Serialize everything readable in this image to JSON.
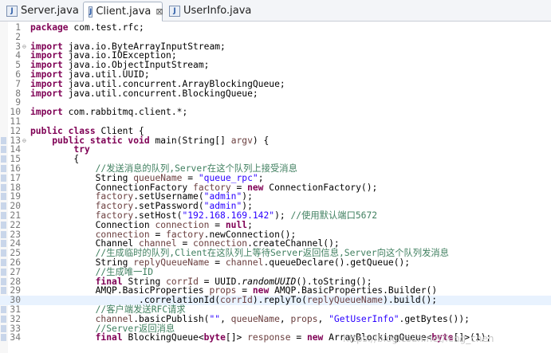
{
  "tabs": [
    {
      "label": "Server.java",
      "icon": "java-file-icon",
      "active": false
    },
    {
      "label": "Client.java",
      "icon": "java-file-icon",
      "active": true,
      "close": "⊠"
    },
    {
      "label": "UserInfo.java",
      "icon": "java-file-icon",
      "active": false
    }
  ],
  "editor": {
    "current_line": 30,
    "lines": [
      {
        "n": "1",
        "t": [
          [
            "kw",
            "package"
          ],
          [
            "",
            "com.test.rfc;"
          ]
        ]
      },
      {
        "n": "2",
        "t": []
      },
      {
        "n": "3",
        "fold": "⊖",
        "t": [
          [
            "kw",
            "import"
          ],
          [
            "",
            "java.io.ByteArrayInputStream;"
          ]
        ]
      },
      {
        "n": "4",
        "t": [
          [
            "kw",
            "import"
          ],
          [
            "",
            "java.io.IOException;"
          ]
        ]
      },
      {
        "n": "5",
        "t": [
          [
            "kw",
            "import"
          ],
          [
            "",
            "java.io.ObjectInputStream;"
          ]
        ]
      },
      {
        "n": "6",
        "t": [
          [
            "kw",
            "import"
          ],
          [
            "",
            "java.util.UUID;"
          ]
        ]
      },
      {
        "n": "7",
        "t": [
          [
            "kw",
            "import"
          ],
          [
            "",
            "java.util.concurrent.ArrayBlockingQueue;"
          ]
        ]
      },
      {
        "n": "8",
        "t": [
          [
            "kw",
            "import"
          ],
          [
            "",
            "java.util.concurrent.BlockingQueue;"
          ]
        ]
      },
      {
        "n": "9",
        "t": []
      },
      {
        "n": "10",
        "t": [
          [
            "kw",
            "import"
          ],
          [
            "",
            "com.rabbitmq.client.*;"
          ]
        ]
      },
      {
        "n": "11",
        "t": []
      },
      {
        "n": "12",
        "t": [
          [
            "kw",
            "public class"
          ],
          [
            "",
            "Client {"
          ]
        ]
      },
      {
        "n": "13",
        "fold": "⊖",
        "t": [
          [
            "",
            "    "
          ],
          [
            "kw",
            "public static void"
          ],
          [
            "",
            "main(String[] "
          ],
          [
            "var",
            "argv"
          ],
          [
            "",
            ") {"
          ]
        ]
      },
      {
        "n": "14",
        "t": [
          [
            "",
            "        "
          ],
          [
            "kw",
            "try"
          ]
        ]
      },
      {
        "n": "15",
        "t": [
          [
            "",
            "        {"
          ]
        ]
      },
      {
        "n": "16",
        "t": [
          [
            "",
            "            "
          ],
          [
            "cmt",
            "//发送消息的队列,Server在这个队列上接受消息"
          ]
        ]
      },
      {
        "n": "17",
        "t": [
          [
            "",
            "            String "
          ],
          [
            "var",
            "queueName"
          ],
          [
            "",
            " = "
          ],
          [
            "str",
            "\"queue_rpc\""
          ],
          [
            "",
            ";"
          ]
        ]
      },
      {
        "n": "18",
        "t": [
          [
            "",
            "            ConnectionFactory "
          ],
          [
            "var",
            "factory"
          ],
          [
            "",
            " = "
          ],
          [
            "kw",
            "new"
          ],
          [
            "",
            " ConnectionFactory();"
          ]
        ]
      },
      {
        "n": "19",
        "t": [
          [
            "",
            "            "
          ],
          [
            "var",
            "factory"
          ],
          [
            "",
            ".setUsername("
          ],
          [
            "str",
            "\"admin\""
          ],
          [
            "",
            ");"
          ]
        ]
      },
      {
        "n": "20",
        "t": [
          [
            "",
            "            "
          ],
          [
            "var",
            "factory"
          ],
          [
            "",
            ".setPassword("
          ],
          [
            "str",
            "\"admin\""
          ],
          [
            "",
            ");"
          ]
        ]
      },
      {
        "n": "21",
        "t": [
          [
            "",
            "            "
          ],
          [
            "var",
            "factory"
          ],
          [
            "",
            ".setHost("
          ],
          [
            "str",
            "\"192.168.169.142\""
          ],
          [
            "",
            "); "
          ],
          [
            "cmt",
            "//使用默认端口5672"
          ]
        ]
      },
      {
        "n": "22",
        "t": [
          [
            "",
            "            Connection "
          ],
          [
            "var",
            "connection"
          ],
          [
            "",
            " = "
          ],
          [
            "kw",
            "null"
          ],
          [
            "",
            ";"
          ]
        ]
      },
      {
        "n": "23",
        "t": [
          [
            "",
            "            "
          ],
          [
            "var",
            "connection"
          ],
          [
            "",
            " = "
          ],
          [
            "var",
            "factory"
          ],
          [
            "",
            ".newConnection();"
          ]
        ]
      },
      {
        "n": "24",
        "t": [
          [
            "",
            "            Channel "
          ],
          [
            "var",
            "channel"
          ],
          [
            "",
            " = "
          ],
          [
            "var",
            "connection"
          ],
          [
            "",
            ".createChannel();"
          ]
        ]
      },
      {
        "n": "25",
        "t": [
          [
            "",
            "            "
          ],
          [
            "cmt",
            "//生成临时的队列,Client在这队列上等待Server返回信息,Server向这个队列发消息"
          ]
        ]
      },
      {
        "n": "26",
        "t": [
          [
            "",
            "            String "
          ],
          [
            "var",
            "replyQueueName"
          ],
          [
            "",
            " = "
          ],
          [
            "var",
            "channel"
          ],
          [
            "",
            ".queueDeclare().getQueue();"
          ]
        ]
      },
      {
        "n": "27",
        "t": [
          [
            "",
            "            "
          ],
          [
            "cmt",
            "//生成唯一ID"
          ]
        ]
      },
      {
        "n": "28",
        "t": [
          [
            "",
            "            "
          ],
          [
            "kw",
            "final"
          ],
          [
            "",
            " String "
          ],
          [
            "var",
            "corrId"
          ],
          [
            "",
            " = UUID."
          ],
          [
            "itl",
            "randomUUID"
          ],
          [
            "",
            "().toString();"
          ]
        ]
      },
      {
        "n": "29",
        "t": [
          [
            "",
            "            AMQP.BasicProperties "
          ],
          [
            "var",
            "props"
          ],
          [
            "",
            " = "
          ],
          [
            "kw",
            "new"
          ],
          [
            "",
            " AMQP.BasicProperties.Builder()"
          ]
        ]
      },
      {
        "n": "30",
        "t": [
          [
            "",
            "                    .correlationId("
          ],
          [
            "var",
            "corrId"
          ],
          [
            "",
            ").replyTo("
          ],
          [
            "var",
            "replyQueueName"
          ],
          [
            "",
            ").build();"
          ]
        ]
      },
      {
        "n": "31",
        "t": [
          [
            "",
            "            "
          ],
          [
            "cmt",
            "//客户端发送RFC请求"
          ]
        ]
      },
      {
        "n": "32",
        "t": [
          [
            "",
            "            "
          ],
          [
            "var",
            "channel"
          ],
          [
            "",
            ".basicPublish("
          ],
          [
            "str",
            "\"\""
          ],
          [
            "",
            ", "
          ],
          [
            "var",
            "queueName"
          ],
          [
            "",
            ", "
          ],
          [
            "var",
            "props"
          ],
          [
            "",
            ", "
          ],
          [
            "str",
            "\"GetUserInfo\""
          ],
          [
            "",
            ".getBytes());"
          ]
        ]
      },
      {
        "n": "33",
        "t": [
          [
            "",
            "            "
          ],
          [
            "cmt",
            "//Server返回消息"
          ]
        ]
      },
      {
        "n": "34",
        "t": [
          [
            "",
            "            "
          ],
          [
            "kw",
            "final"
          ],
          [
            "",
            " BlockingQueue<"
          ],
          [
            "kw",
            "byte"
          ],
          [
            "",
            "[]> "
          ],
          [
            "var",
            "response"
          ],
          [
            "",
            " = "
          ],
          [
            "kw",
            "new"
          ],
          [
            "",
            " ArrayBlockingQueue<"
          ],
          [
            "kw",
            "byte"
          ],
          [
            "",
            "[]>(1);"
          ]
        ]
      }
    ]
  },
  "watermark": "https://blog.csdn.net/leng_chen"
}
